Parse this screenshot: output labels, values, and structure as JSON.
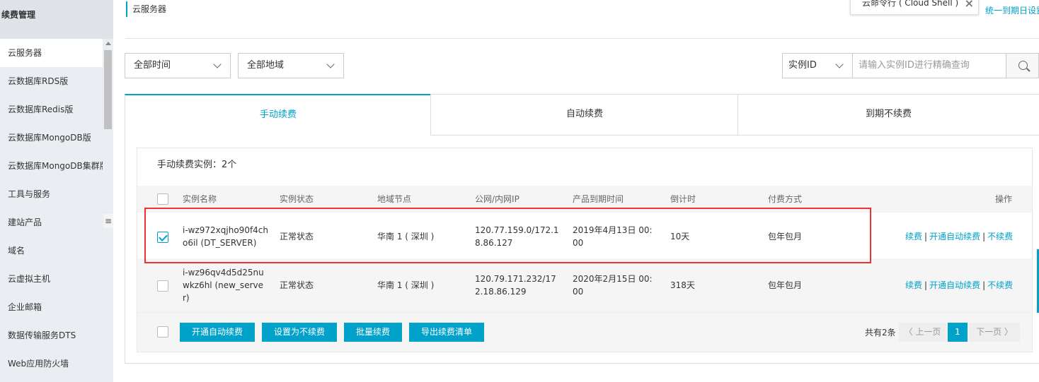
{
  "sidebar": {
    "header": "续费管理",
    "items": [
      {
        "label": "云服务器"
      },
      {
        "label": "云数据库RDS版"
      },
      {
        "label": "云数据库Redis版"
      },
      {
        "label": "云数据库MongoDB版"
      },
      {
        "label": "云数据库MongoDB集群版"
      },
      {
        "label": "工具与服务"
      },
      {
        "label": "建站产品"
      },
      {
        "label": "域名"
      },
      {
        "label": "云虚拟主机"
      },
      {
        "label": "企业邮箱"
      },
      {
        "label": "数据传输服务DTS"
      },
      {
        "label": "Web应用防火墙"
      }
    ],
    "collapse_icon": "≡"
  },
  "header": {
    "title": "云服务器",
    "cloud_shell": "云命令行 ( Cloud Shell )",
    "close_icon": "×",
    "unify_link": "统一到期日设置"
  },
  "filters": {
    "time": "全部时间",
    "region": "全部地域",
    "id_type": "实例ID",
    "search_placeholder": "请输入实例ID进行精确查询"
  },
  "tabs": [
    "手动续费",
    "自动续费",
    "到期不续费"
  ],
  "panel": {
    "count_text": "手动续费实例：2个",
    "columns": [
      "实例名称",
      "实例状态",
      "地域节点",
      "公网/内网IP",
      "产品到期时间",
      "倒计时",
      "付费方式",
      "操作"
    ],
    "rows": [
      {
        "checked": true,
        "name1": "i-wz972xqjho90f4ch",
        "name2": "o6il (DT_SERVER)",
        "status": "正常状态",
        "region": "华南 1 ( 深圳 )",
        "ip1": "120.77.159.0/172.1",
        "ip2": "8.86.127",
        "expire1": "2019年4月13日 00:",
        "expire2": "00",
        "countdown": "10天",
        "pay": "包年包月",
        "op_renew": "续费",
        "op_auto": "开通自动续费",
        "op_no": "不续费"
      },
      {
        "checked": false,
        "name1": "i-wz96qv4d5d25nu",
        "name2": "wkz6hl (new_serve",
        "name3": "r)",
        "status": "正常状态",
        "region": "华南 1 ( 深圳 )",
        "ip1": "120.79.171.232/17",
        "ip2": "2.18.86.129",
        "expire1": "2020年2月15日 00:",
        "expire2": "00",
        "countdown": "318天",
        "pay": "包年包月",
        "op_renew": "续费",
        "op_auto": "开通自动续费",
        "op_no": "不续费"
      }
    ],
    "separator": "|"
  },
  "footer": {
    "btn_auto": "开通自动续费",
    "btn_no": "设置为不续费",
    "btn_batch": "批量续费",
    "btn_export": "导出续费清单",
    "total": "共有2条",
    "prev": "〈 上一页",
    "page": "1",
    "next": "下一页 〉"
  }
}
